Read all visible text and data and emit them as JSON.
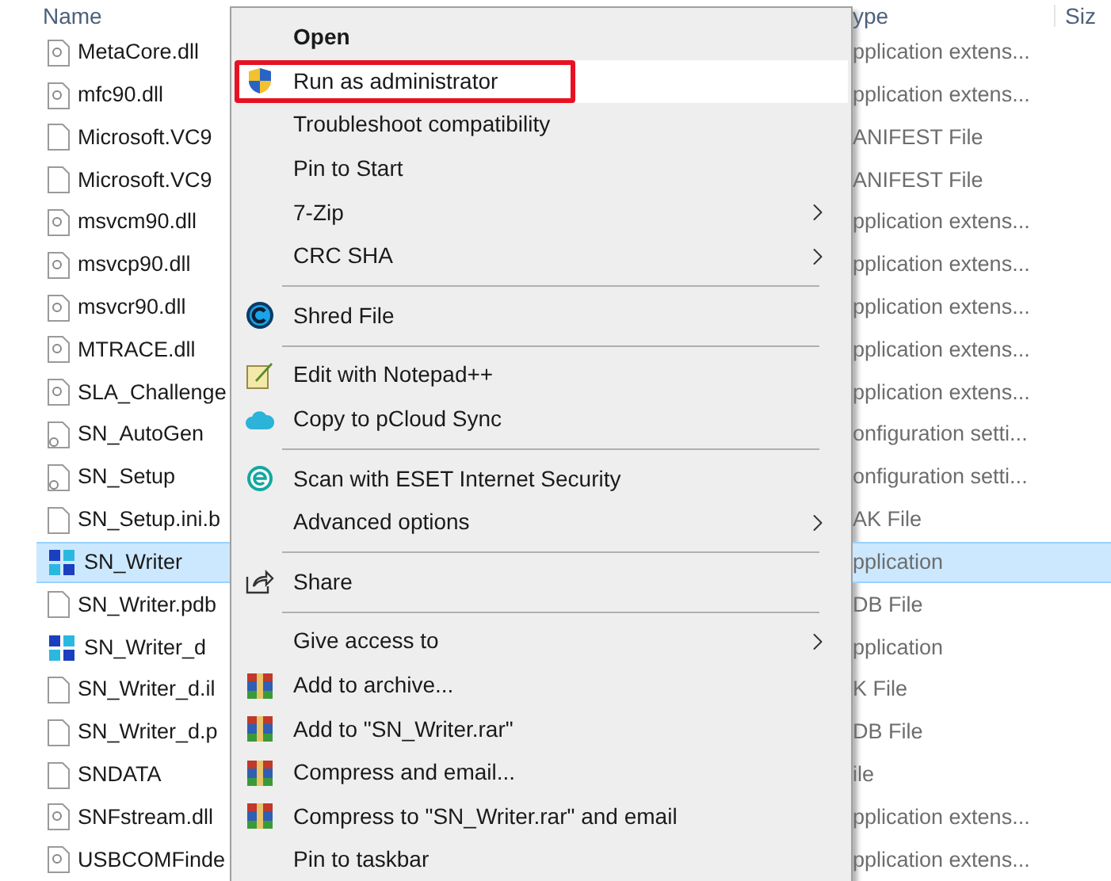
{
  "file_list": {
    "columns": [
      {
        "label": "Name"
      },
      {
        "label": "ype"
      },
      {
        "label": "Siz"
      }
    ],
    "rows": [
      {
        "name": "MetaCore.dll",
        "type": "pplication extens...",
        "kind": "dll",
        "selected": false
      },
      {
        "name": "mfc90.dll",
        "type": "pplication extens...",
        "kind": "dll",
        "selected": false
      },
      {
        "name": "Microsoft.VC9",
        "type": "ANIFEST File",
        "kind": "file",
        "selected": false
      },
      {
        "name": "Microsoft.VC9",
        "type": "ANIFEST File",
        "kind": "file",
        "selected": false
      },
      {
        "name": "msvcm90.dll",
        "type": "pplication extens...",
        "kind": "dll",
        "selected": false
      },
      {
        "name": "msvcp90.dll",
        "type": "pplication extens...",
        "kind": "dll",
        "selected": false
      },
      {
        "name": "msvcr90.dll",
        "type": "pplication extens...",
        "kind": "dll",
        "selected": false
      },
      {
        "name": "MTRACE.dll",
        "type": "pplication extens...",
        "kind": "dll",
        "selected": false
      },
      {
        "name": "SLA_Challenge",
        "type": "pplication extens...",
        "kind": "dll",
        "selected": false
      },
      {
        "name": "SN_AutoGen",
        "type": "onfiguration setti...",
        "kind": "config",
        "selected": false
      },
      {
        "name": "SN_Setup",
        "type": "onfiguration setti...",
        "kind": "config",
        "selected": false
      },
      {
        "name": "SN_Setup.ini.b",
        "type": "AK File",
        "kind": "file",
        "selected": false
      },
      {
        "name": "SN_Writer",
        "type": "pplication",
        "kind": "app",
        "selected": true
      },
      {
        "name": "SN_Writer.pdb",
        "type": "DB File",
        "kind": "file",
        "selected": false
      },
      {
        "name": "SN_Writer_d",
        "type": "pplication",
        "kind": "app",
        "selected": false
      },
      {
        "name": "SN_Writer_d.il",
        "type": "K File",
        "kind": "file",
        "selected": false
      },
      {
        "name": "SN_Writer_d.p",
        "type": "DB File",
        "kind": "file",
        "selected": false
      },
      {
        "name": "SNDATA",
        "type": "ile",
        "kind": "file",
        "selected": false
      },
      {
        "name": "SNFstream.dll",
        "type": "pplication extens...",
        "kind": "dll",
        "selected": false
      },
      {
        "name": "USBCOMFinde",
        "type": "pplication extens...",
        "kind": "dll",
        "selected": false
      }
    ]
  },
  "context_menu": {
    "items": [
      {
        "kind": "item",
        "label": "Open",
        "bold": true,
        "highlighted": false,
        "outlined": false,
        "submenu": false
      },
      {
        "kind": "item",
        "label": "Run as administrator",
        "bold": false,
        "highlighted": true,
        "outlined": true,
        "submenu": false
      },
      {
        "kind": "item",
        "label": "Troubleshoot compatibility",
        "bold": false,
        "highlighted": false,
        "outlined": false,
        "submenu": false
      },
      {
        "kind": "item",
        "label": "Pin to Start",
        "bold": false,
        "highlighted": false,
        "outlined": false,
        "submenu": false
      },
      {
        "kind": "item",
        "label": "7-Zip",
        "bold": false,
        "highlighted": false,
        "outlined": false,
        "submenu": true
      },
      {
        "kind": "item",
        "label": "CRC SHA",
        "bold": false,
        "highlighted": false,
        "outlined": false,
        "submenu": true
      },
      {
        "kind": "separator"
      },
      {
        "kind": "item",
        "label": "Shred File",
        "bold": false,
        "highlighted": false,
        "outlined": false,
        "submenu": false
      },
      {
        "kind": "separator"
      },
      {
        "kind": "item",
        "label": "Edit with Notepad++",
        "bold": false,
        "highlighted": false,
        "outlined": false,
        "submenu": false
      },
      {
        "kind": "item",
        "label": "Copy to pCloud Sync",
        "bold": false,
        "highlighted": false,
        "outlined": false,
        "submenu": false
      },
      {
        "kind": "separator"
      },
      {
        "kind": "item",
        "label": "Scan with ESET Internet Security",
        "bold": false,
        "highlighted": false,
        "outlined": false,
        "submenu": false
      },
      {
        "kind": "item",
        "label": "Advanced options",
        "bold": false,
        "highlighted": false,
        "outlined": false,
        "submenu": true
      },
      {
        "kind": "separator"
      },
      {
        "kind": "item",
        "label": "Share",
        "bold": false,
        "highlighted": false,
        "outlined": false,
        "submenu": false
      },
      {
        "kind": "separator"
      },
      {
        "kind": "item",
        "label": "Give access to",
        "bold": false,
        "highlighted": false,
        "outlined": false,
        "submenu": true
      },
      {
        "kind": "item",
        "label": "Add to archive...",
        "bold": false,
        "highlighted": false,
        "outlined": false,
        "submenu": false
      },
      {
        "kind": "item",
        "label": "Add to \"SN_Writer.rar\"",
        "bold": false,
        "highlighted": false,
        "outlined": false,
        "submenu": false
      },
      {
        "kind": "item",
        "label": "Compress and email...",
        "bold": false,
        "highlighted": false,
        "outlined": false,
        "submenu": false
      },
      {
        "kind": "item",
        "label": "Compress to \"SN_Writer.rar\" and email",
        "bold": false,
        "highlighted": false,
        "outlined": false,
        "submenu": false
      },
      {
        "kind": "item",
        "label": "Pin to taskbar",
        "bold": false,
        "highlighted": false,
        "outlined": false,
        "submenu": false
      }
    ]
  }
}
